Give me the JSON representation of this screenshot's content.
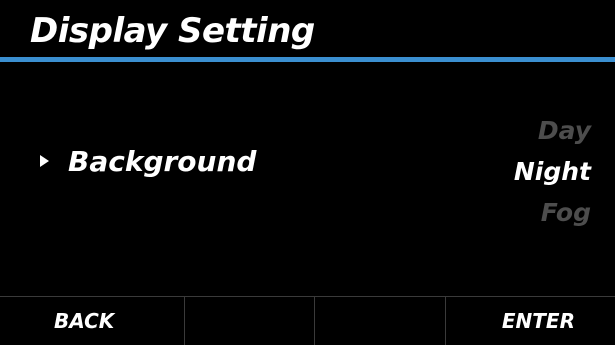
{
  "header": {
    "title": "Display Setting",
    "accent_color": "#3b8fd0"
  },
  "setting": {
    "pointer_icon": "pointer-arrow-icon",
    "label": "Background",
    "options": [
      {
        "label": "Day",
        "selected": false
      },
      {
        "label": "Night",
        "selected": true
      },
      {
        "label": "Fog",
        "selected": false
      }
    ]
  },
  "softkeys": {
    "key1": "BACK",
    "key2": "",
    "key3": "",
    "key4": "ENTER"
  }
}
